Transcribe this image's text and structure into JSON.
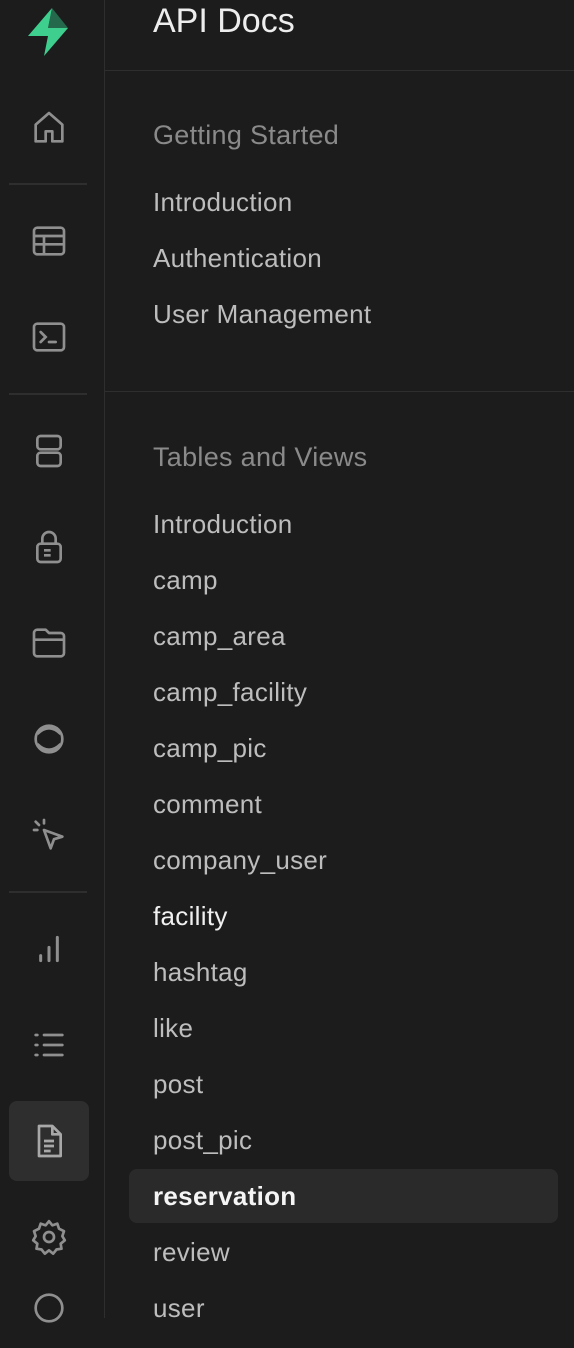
{
  "header": {
    "title": "API Docs"
  },
  "sections": [
    {
      "title": "Getting Started",
      "items": [
        "Introduction",
        "Authentication",
        "User Management"
      ]
    },
    {
      "title": "Tables and Views",
      "items": [
        "Introduction",
        "camp",
        "camp_area",
        "camp_facility",
        "camp_pic",
        "comment",
        "company_user",
        "facility",
        "hashtag",
        "like",
        "post",
        "post_pic",
        "reservation",
        "review",
        "user"
      ]
    }
  ],
  "highlighted_item": "facility",
  "selected_item": "reservation",
  "rail": {
    "icons": [
      "supabase-logo-icon",
      "home-icon",
      "table-editor-icon",
      "sql-terminal-icon",
      "database-icon",
      "auth-lock-icon",
      "storage-folder-icon",
      "realtime-icon",
      "edge-functions-cursor-icon",
      "reports-chart-icon",
      "logs-list-icon",
      "api-docs-icon",
      "settings-gear-icon",
      "help-circle-icon"
    ],
    "accent_color": "#3ecf8e",
    "active": "api-docs-icon"
  }
}
